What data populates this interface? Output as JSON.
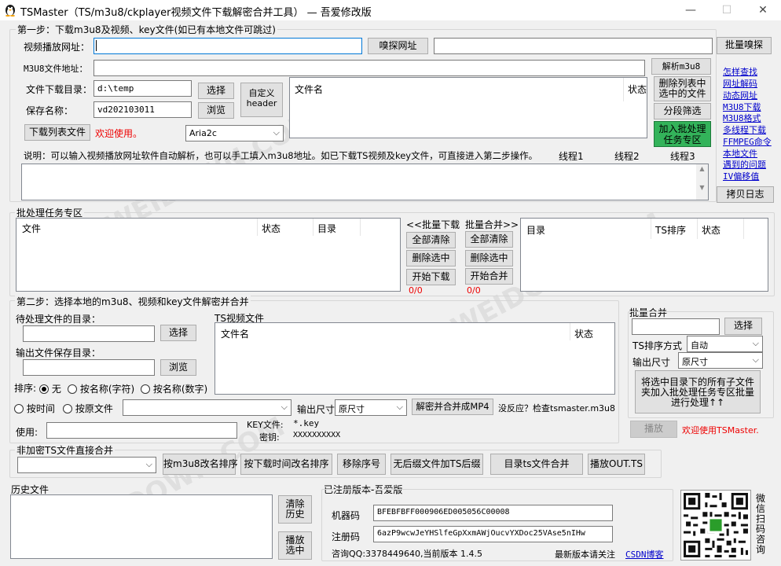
{
  "window": {
    "title": "TSMaster（TS/m3u8/ckplayer视频文件下载解密合并工具） — 吾爱修改版",
    "minimize": "—",
    "maximize": "☐",
    "close": "✕"
  },
  "step1": {
    "legend": "第一步：下载m3u8及视频、key文件(如已有本地文件可跳过)",
    "video_url_label": "视频播放网址：",
    "video_url_value": "",
    "sniff_button": "嗅探网址",
    "batch_sniff_input": "",
    "batch_sniff_button": "批量嗅探",
    "m3u8_label": "M3U8文件地址：",
    "m3u8_value": "",
    "parse_button": "解析m3u8",
    "dir_label": "文件下载目录：",
    "dir_value": "d:\\temp",
    "dir_select_button": "选择",
    "save_label": "保存名称：",
    "save_value": "vd202103011",
    "browse_button": "浏览",
    "custom_header_button": "自定义 header",
    "file_list_headers": [
      "文件名",
      "状态"
    ],
    "delete_selected_button": "删除列表中选中的文件",
    "segment_filter_button": "分段筛选",
    "add_batch_button": "加入批处理任务专区",
    "download_list_button": "下载列表文件",
    "welcome_text": "欢迎使用。",
    "downloader_select": "Aria2c",
    "note": "说明：可以输入视频播放网址软件自动解析，也可以手工填入m3u8地址。如已下载TS视频及key文件，可直接进入第二步操作。",
    "thread_labels": [
      "线程1",
      "线程2",
      "线程3"
    ],
    "log_text": "",
    "copy_log_button": "拷贝日志"
  },
  "side_links": [
    "怎样查找",
    "网址解码",
    "动态网址",
    "M3U8下载",
    "M3U8格式",
    "多线程下载",
    "FFMPEG命令",
    "本地文件",
    "遇到的问题",
    "IV偏移值"
  ],
  "batch": {
    "legend": "批处理任务专区",
    "left_headers": [
      "文件",
      "状态",
      "目录"
    ],
    "download_title": "<<批量下载",
    "merge_title": "批量合并>>",
    "clear_all_left": "全部清除",
    "delete_selected_left": "删除选中",
    "start_download": "开始下载",
    "download_count": "0/0",
    "clear_all_right": "全部清除",
    "delete_selected_right": "删除选中",
    "start_merge": "开始合并",
    "merge_count": "0/0",
    "right_headers": [
      "目录",
      "TS排序",
      "状态"
    ]
  },
  "step2": {
    "legend": "第二步：选择本地的m3u8、视频和key文件解密并合并",
    "pending_dir_label": "待处理文件的目录：",
    "pending_dir_value": "",
    "pending_select_button": "选择",
    "output_dir_label": "输出文件保存目录：",
    "output_dir_value": "",
    "output_browse_button": "浏览",
    "ts_files_label": "TS视频文件",
    "ts_headers": [
      "文件名",
      "状态"
    ],
    "sort_label": "排序:",
    "sort_options": [
      "无",
      "按名称(字符)",
      "按名称(数字)",
      "按时间",
      "按原文件"
    ],
    "sort_selected": 0,
    "file_select_value": "",
    "output_size_label": "输出尺寸",
    "output_size_value": "原尺寸",
    "decrypt_merge_button": "解密并合并成MP4",
    "no_response_text": "没反应？检查tsmaster.m3u8",
    "use_label": "使用:",
    "use_value": "",
    "key_file_label": "KEY文件:",
    "key_file_value": "*.key",
    "key_label": "密钥:",
    "key_value": "XXXXXXXXXX"
  },
  "batch_merge": {
    "title": "批量合并",
    "dir_value": "",
    "select_button": "选择",
    "ts_sort_label": "TS排序方式",
    "ts_sort_value": "自动",
    "output_size_label": "输出尺寸",
    "output_size_value": "原尺寸",
    "add_subfolders_button": "将选中目录下的所有子文件夹加入批处理任务专区批量进行处理↑↑"
  },
  "play": {
    "play_button": "播放",
    "welcome": "欢迎使用TSMaster."
  },
  "plain_merge": {
    "legend": "非加密TS文件直接合并",
    "select_value": "",
    "buttons": [
      "按m3u8改名排序",
      "按下载时间改名排序",
      "移除序号",
      "无后缀文件加TS后缀",
      "目录ts文件合并",
      "播放OUT.TS"
    ]
  },
  "history": {
    "label": "历史文件",
    "clear_button": "清除历史",
    "play_selected_button": "播放选中"
  },
  "registration": {
    "legend": "已注册版本-吾爱版",
    "machine_label": "机器码",
    "machine_value": "BFEBFBFF000906ED005056C00008",
    "reg_label": "注册码",
    "reg_value": "6azP9wcwJeYHSlfeGpXxmAWjOucvYXDoc25VAse5nIHw",
    "contact": "咨询QQ:3378449640,当前版本  1.4.5",
    "latest_text": "最新版本请关注",
    "csdn_link": "CSDN博客",
    "wechat_text": "微信扫码咨询"
  },
  "colors": {
    "accent_green": "#33b35a",
    "link_blue": "#0000cc",
    "warn_red": "#ee0000"
  }
}
